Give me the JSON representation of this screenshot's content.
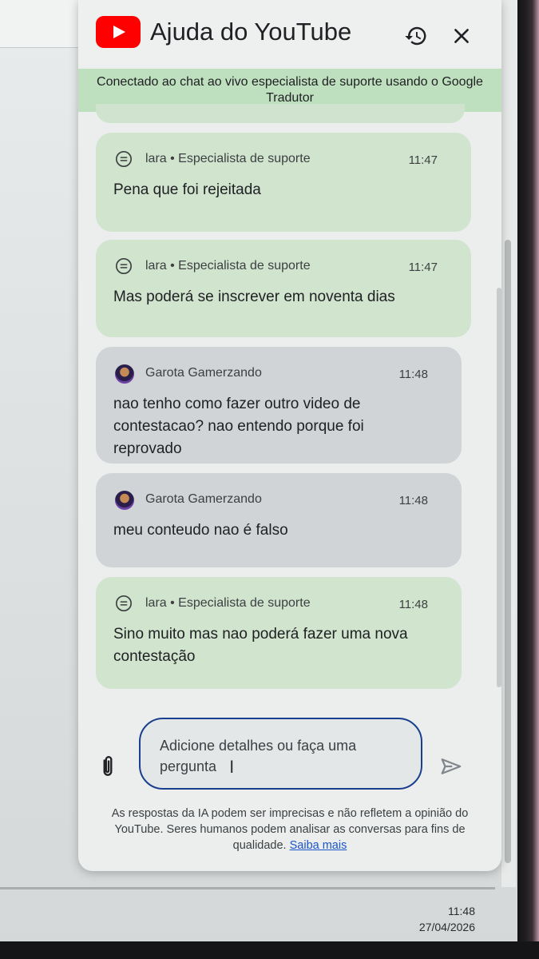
{
  "header": {
    "title": "Ajuda do YouTube",
    "logo_icon": "youtube-logo",
    "history_icon": "history-icon",
    "close_icon": "close-icon"
  },
  "banner": {
    "text": "Conectado ao chat ao vivo especialista de suporte usando o Google Tradutor"
  },
  "messages": [
    {
      "type": "agent",
      "sender": "lara • Especialista de suporte",
      "time": "11:47",
      "text": "Pena que foi rejeitada"
    },
    {
      "type": "agent",
      "sender": "lara • Especialista de suporte",
      "time": "11:47",
      "text": "Mas poderá se inscrever em noventa dias"
    },
    {
      "type": "user",
      "sender": "Garota Gamerzando",
      "time": "11:48",
      "text": "nao tenho como fazer outro video de contestacao? nao entendo porque foi reprovado"
    },
    {
      "type": "user",
      "sender": "Garota Gamerzando",
      "time": "11:48",
      "text": "meu conteudo nao é falso"
    },
    {
      "type": "agent",
      "sender": "lara • Especialista de suporte",
      "time": "11:48",
      "text": "Sino muito mas nao poderá fazer uma nova contestação"
    }
  ],
  "composer": {
    "placeholder": "Adicione detalhes ou faça uma pergunta",
    "attach_icon": "paperclip-icon",
    "send_icon": "send-icon"
  },
  "disclaimer": {
    "text": "As respostas da IA podem ser imprecisas e não refletem a opinião do YouTube. Seres humanos podem analisar as conversas para fins de qualidade.",
    "link": "Saiba mais"
  },
  "taskbar": {
    "time": "11:48",
    "date": "27/04/2026"
  },
  "colors": {
    "youtube_red": "#ff0000",
    "agent_bubble": "#d0e4ce",
    "user_bubble": "#d1d4d6",
    "banner": "#bfe0bf",
    "input_border": "#1a3f8f",
    "link": "#1a55c9"
  }
}
